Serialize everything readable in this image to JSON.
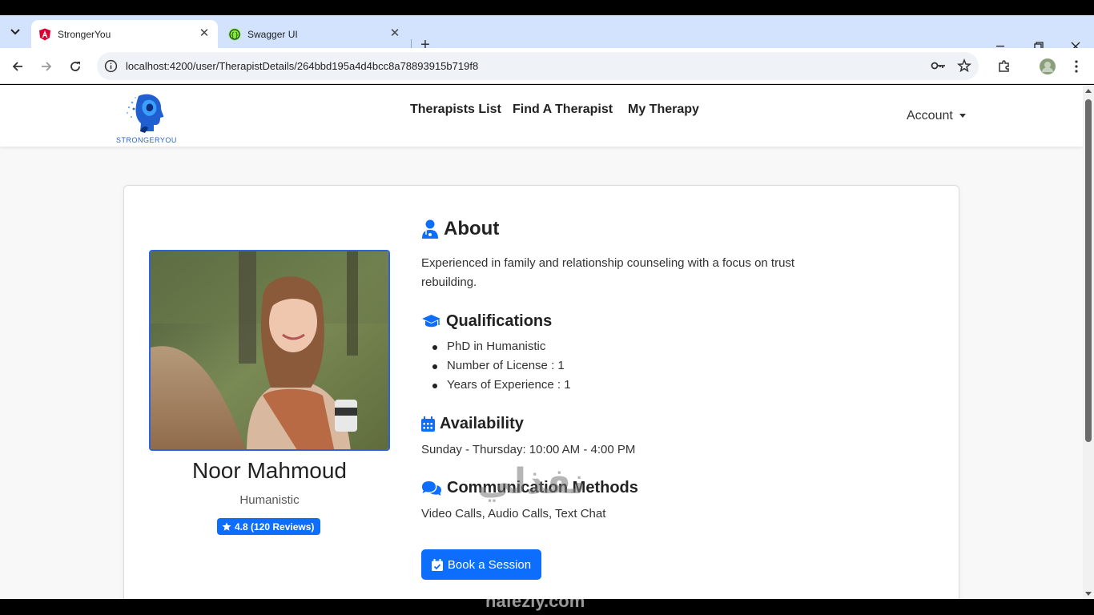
{
  "browser": {
    "tabs": [
      {
        "title": "StrongerYou",
        "active": true,
        "favicon": "angular-icon"
      },
      {
        "title": "Swagger UI",
        "active": false,
        "favicon": "swagger-icon"
      }
    ],
    "url": "localhost:4200/user/TherapistDetails/264bbd195a4d4bcc8a78893915b719f8"
  },
  "navbar": {
    "brand": "STRONGERYOU",
    "links": [
      "Therapists List",
      "Find A Therapist",
      "My Therapy"
    ],
    "account": "Account"
  },
  "therapist": {
    "name": "Noor Mahmoud",
    "specialty": "Humanistic",
    "rating": "4.8 (120 Reviews)"
  },
  "about": {
    "title": "About",
    "text_line1": "Experienced in family and relationship counseling with a focus on trust",
    "text_line2": "rebuilding."
  },
  "qualifications": {
    "title": "Qualifications",
    "items": [
      "PhD in Humanistic",
      "Number of License : 1",
      "Years of Experience : 1"
    ]
  },
  "availability": {
    "title": "Availability",
    "text": "Sunday - Thursday: 10:00 AM - 4:00 PM"
  },
  "communication": {
    "title": "Communication Methods",
    "text": "Video Calls, Audio Calls, Text Chat"
  },
  "actions": {
    "book": "Book a Session"
  },
  "watermark": {
    "arabic": "نفذلي",
    "latin": "nafezly.com"
  },
  "colors": {
    "primary": "#0d6efd",
    "tabstrip": "#d3e3fd"
  }
}
